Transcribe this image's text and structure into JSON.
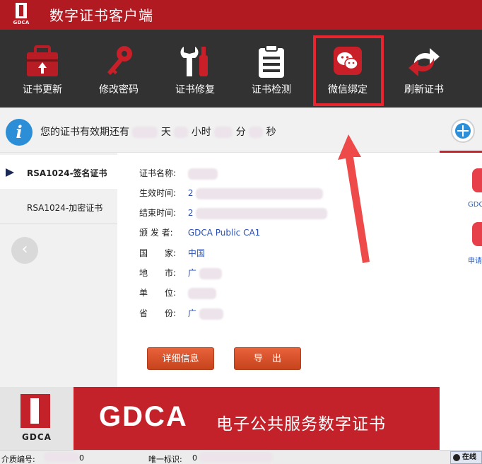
{
  "window": {
    "title": "数字证书客户端",
    "logo_text": "GDCA"
  },
  "toolbar": {
    "items": [
      {
        "label": "证书更新",
        "icon": "toolbox-upload-icon"
      },
      {
        "label": "修改密码",
        "icon": "key-icon"
      },
      {
        "label": "证书修复",
        "icon": "wrench-icon"
      },
      {
        "label": "证书检测",
        "icon": "clipboard-icon"
      },
      {
        "label": "微信绑定",
        "icon": "wechat-icon"
      },
      {
        "label": "刷新证书",
        "icon": "refresh-icon"
      }
    ]
  },
  "validity": {
    "prefix": "您的证书有效期还有",
    "day": "天",
    "hour": "小时",
    "minute": "分",
    "second": "秒"
  },
  "cert_list": [
    {
      "label": "RSA1024-签名证书",
      "selected": true
    },
    {
      "label": "RSA1024-加密证书",
      "selected": false
    }
  ],
  "details": {
    "name_label": "证书名称:",
    "name_value": "",
    "start_label": "生效时间:",
    "start_value": "2",
    "end_label": "结束时间:",
    "end_value": "2",
    "issuer_label": "颁 发 者:",
    "issuer_value": "GDCA Public CA1",
    "country_label": "国　　家:",
    "country_value": "中国",
    "city_label": "地　　市:",
    "city_value": "广",
    "org_label": "单　　位:",
    "org_value": "",
    "province_label": "省　　份:",
    "province_value": "广"
  },
  "buttons": {
    "detail": "详细信息",
    "export": "导　出"
  },
  "side": {
    "label_1": "GDC",
    "label_2": "申请"
  },
  "banner": {
    "logo_text": "GDCA",
    "brand": "GDCA",
    "slogan": "电子公共服务数字证书"
  },
  "status": {
    "media_label": "介质编号:",
    "media_value": "0",
    "uid_label": "唯一标识:",
    "uid_value": "0",
    "online": "在线"
  },
  "colors": {
    "title_red": "#b21a21",
    "toolbar": "#323232",
    "highlight": "#e8242e",
    "link_blue": "#2a4fb4",
    "button": "#d5522a"
  }
}
